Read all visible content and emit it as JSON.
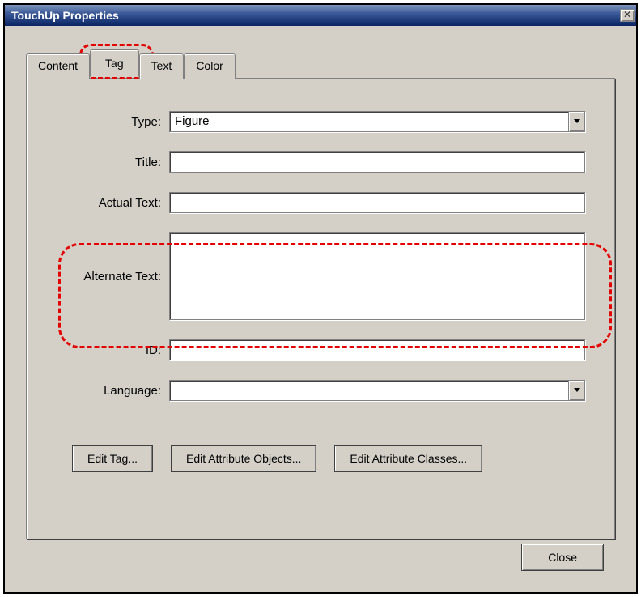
{
  "window": {
    "title": "TouchUp Properties",
    "close_glyph": "✕"
  },
  "tabs": {
    "content": "Content",
    "tag": "Tag",
    "text": "Text",
    "color": "Color"
  },
  "form": {
    "type_label": "Type:",
    "type_value": "Figure",
    "title_label": "Title:",
    "title_value": "",
    "actual_text_label": "Actual Text:",
    "actual_text_value": "",
    "alternate_text_label": "Alternate Text:",
    "alternate_text_value": "",
    "id_label": "ID:",
    "id_value": "",
    "language_label": "Language:",
    "language_value": ""
  },
  "buttons": {
    "edit_tag": "Edit Tag...",
    "edit_attr_objects": "Edit Attribute Objects...",
    "edit_attr_classes": "Edit Attribute Classes...",
    "close": "Close"
  }
}
